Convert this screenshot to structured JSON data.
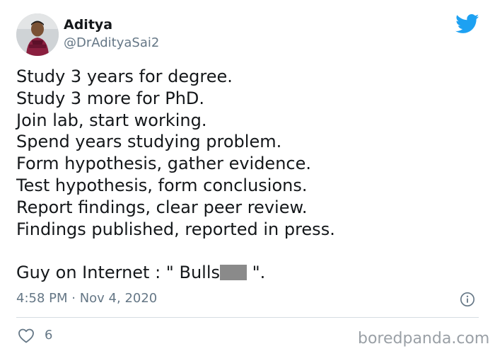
{
  "author": {
    "display_name": "Aditya",
    "handle": "@DrAdityaSai2"
  },
  "tweet": {
    "lines": [
      "Study 3 years for degree.",
      "Study 3 more for PhD.",
      "Join lab, start working.",
      "Spend years studying problem.",
      "Form hypothesis, gather evidence.",
      "Test hypothesis, form conclusions.",
      "Report findings, clear peer review.",
      "Findings published, reported in press."
    ],
    "last_line_before": "Guy on Internet : \" Bulls",
    "last_line_after": " \"."
  },
  "meta": {
    "timestamp": "4:58 PM · Nov 4, 2020",
    "like_count": "6"
  },
  "watermark": "boredpanda.com",
  "icons": {
    "brand": "twitter-bird-icon",
    "info": "info-icon",
    "like": "heart-icon"
  },
  "colors": {
    "twitter_blue": "#1da1f2",
    "secondary_text": "#657786",
    "redaction": "#8a8a8a"
  }
}
